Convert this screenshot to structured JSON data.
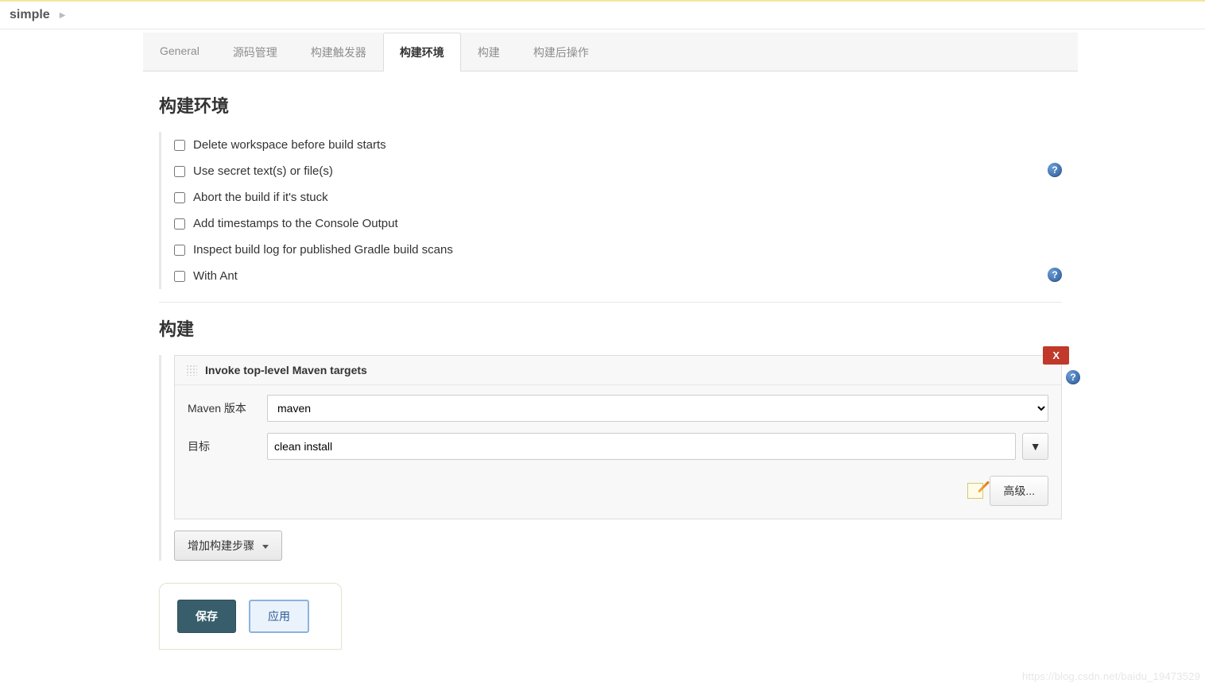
{
  "breadcrumb": {
    "item": "simple"
  },
  "tabs": [
    {
      "label": "General"
    },
    {
      "label": "源码管理"
    },
    {
      "label": "构建触发器"
    },
    {
      "label": "构建环境"
    },
    {
      "label": "构建"
    },
    {
      "label": "构建后操作"
    }
  ],
  "activeTabIndex": 3,
  "sections": {
    "build_env": {
      "heading": "构建环境",
      "options": [
        {
          "label": "Delete workspace before build starts",
          "checked": false,
          "help": false
        },
        {
          "label": "Use secret text(s) or file(s)",
          "checked": false,
          "help": true
        },
        {
          "label": "Abort the build if it's stuck",
          "checked": false,
          "help": false
        },
        {
          "label": "Add timestamps to the Console Output",
          "checked": false,
          "help": false
        },
        {
          "label": "Inspect build log for published Gradle build scans",
          "checked": false,
          "help": false
        },
        {
          "label": "With Ant",
          "checked": false,
          "help": true
        }
      ]
    },
    "build": {
      "heading": "构建",
      "step": {
        "title": "Invoke top-level Maven targets",
        "remove_label": "X",
        "fields": {
          "maven_version_label": "Maven 版本",
          "maven_version_value": "maven",
          "goals_label": "目标",
          "goals_value": "clean install"
        },
        "advanced_label": "高级..."
      },
      "add_step_label": "增加构建步骤"
    }
  },
  "footer": {
    "save_label": "保存",
    "apply_label": "应用"
  },
  "watermark": "https://blog.csdn.net/baidu_19473529",
  "icons": {
    "help": "?",
    "arrow_down": "▼"
  }
}
